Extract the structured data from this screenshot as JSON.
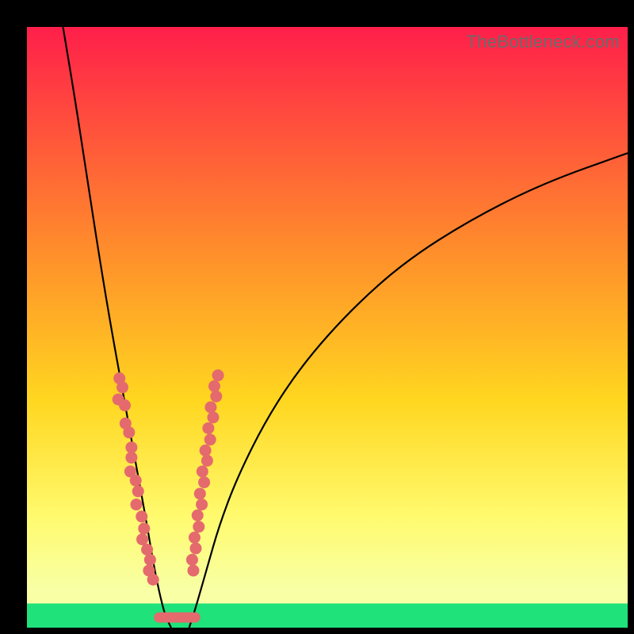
{
  "watermark": "TheBottleneck.com",
  "colors": {
    "top": "#ff1f4a",
    "mid1": "#ff8a2c",
    "mid2": "#ffd61f",
    "mid3": "#fffb70",
    "band": "#f8ffa4",
    "bottom": "#1fe27a",
    "curve": "#000000",
    "dot": "#e46a6d"
  },
  "chart_data": {
    "type": "line",
    "title": "",
    "xlabel": "",
    "ylabel": "",
    "xlim": [
      0,
      100
    ],
    "ylim": [
      0,
      100
    ],
    "grid": false,
    "series": [
      {
        "name": "left-curve",
        "x": [
          6,
          8,
          10,
          12,
          14,
          16,
          18,
          20,
          21,
          22,
          23,
          24
        ],
        "y": [
          100,
          88,
          75,
          62,
          50,
          39,
          28,
          17,
          11,
          6,
          2,
          0
        ]
      },
      {
        "name": "right-curve",
        "x": [
          27,
          28,
          30,
          32,
          35,
          40,
          46,
          54,
          63,
          74,
          86,
          100
        ],
        "y": [
          0,
          3,
          10,
          17,
          25,
          35,
          44,
          53,
          61,
          68,
          74,
          79
        ]
      }
    ],
    "point_clusters": [
      {
        "name": "left-dot-cluster",
        "points": [
          [
            15.4,
            41.5
          ],
          [
            15.9,
            40.0
          ],
          [
            15.2,
            38.0
          ],
          [
            16.3,
            37.0
          ],
          [
            16.4,
            34.0
          ],
          [
            17.0,
            32.5
          ],
          [
            17.4,
            30.0
          ],
          [
            17.4,
            28.3
          ],
          [
            17.2,
            26.0
          ],
          [
            18.1,
            24.5
          ],
          [
            18.5,
            22.7
          ],
          [
            18.2,
            20.5
          ],
          [
            19.1,
            18.5
          ],
          [
            19.5,
            16.5
          ],
          [
            19.2,
            14.7
          ],
          [
            20.0,
            13.0
          ],
          [
            20.5,
            11.3
          ],
          [
            20.3,
            9.5
          ],
          [
            21.0,
            8.0
          ]
        ]
      },
      {
        "name": "right-dot-cluster",
        "points": [
          [
            31.8,
            42.0
          ],
          [
            31.2,
            40.2
          ],
          [
            31.5,
            38.5
          ],
          [
            30.6,
            36.7
          ],
          [
            31.0,
            35.0
          ],
          [
            30.2,
            33.2
          ],
          [
            30.5,
            31.3
          ],
          [
            29.7,
            29.5
          ],
          [
            30.0,
            27.8
          ],
          [
            29.2,
            26.0
          ],
          [
            29.5,
            24.2
          ],
          [
            28.8,
            22.3
          ],
          [
            29.1,
            20.5
          ],
          [
            28.4,
            18.7
          ],
          [
            28.6,
            16.8
          ],
          [
            27.9,
            15.0
          ],
          [
            28.1,
            13.2
          ],
          [
            27.5,
            11.3
          ],
          [
            27.7,
            9.5
          ]
        ]
      }
    ],
    "bottom_streak": {
      "x1": 22.0,
      "x2": 28.0,
      "y": 1.7
    }
  }
}
